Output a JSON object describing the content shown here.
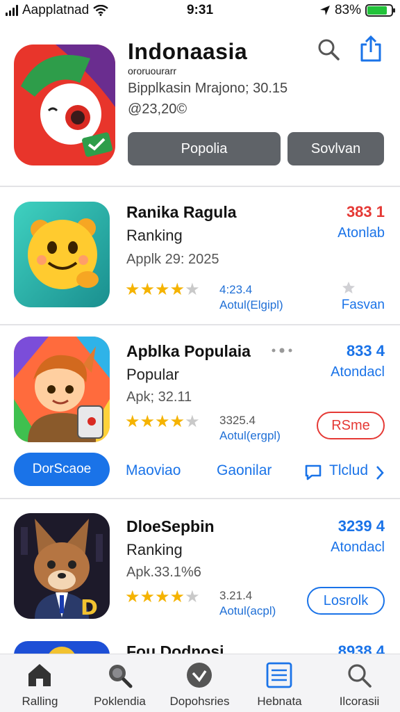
{
  "status_bar": {
    "carrier": "Aapplatnad",
    "time": "9:31",
    "battery": "83%",
    "battery_level": 0.83
  },
  "featured": {
    "title": "Indonaasia",
    "subtitle": "ororuourarr",
    "line1": "Bipplkasin Mrajono; 30.15",
    "line2": "@23,20©",
    "primary_button": "Popolia",
    "secondary_button": "Sovlvan",
    "icons": [
      "search-icon",
      "share-icon"
    ]
  },
  "apps": [
    {
      "name": "Ranika Ragula",
      "category": "Ranking",
      "version": "Applk 29: 2025",
      "rating": 4,
      "rating_value": "4:23.4",
      "rating_label": "Aotul(Elgipl)",
      "price": "383 1",
      "price_color": "#e53935",
      "link": "Atonlab",
      "action_label": "Fasvan",
      "action_icon": "star-icon"
    },
    {
      "name": "Apblka Populaia",
      "category": "Popular",
      "version": "Apk; 32.11",
      "rating": 4,
      "rating_value": "3325.4",
      "rating_label": "Aotul(ergpl)",
      "price": "833 4",
      "price_color": "#1a73e8",
      "link": "Atondacl",
      "action_label": "RSme",
      "action_color": "#e53935",
      "more_icon": "more-dots-icon"
    },
    {
      "name": "DloeSepbin",
      "category": "Ranking",
      "version": "Apk.33.1%6",
      "rating": 4,
      "rating_value": "3.21.4",
      "rating_label": "Aotul(acpl)",
      "price": "3239 4",
      "price_color": "#1a73e8",
      "link": "Atondacl",
      "action_label": "Losrolk",
      "action_color": "#1a73e8"
    },
    {
      "name": "Fou Dodnosi",
      "price": "8938 4",
      "price_color": "#1a73e8"
    }
  ],
  "actions_bar": {
    "button": "DorScaoe",
    "link1": "Maoviao",
    "link2": "Gaonilar",
    "link3": "Tlclud"
  },
  "tab_bar": [
    {
      "label": "Ralling",
      "icon": "home-icon"
    },
    {
      "label": "Poklendia",
      "icon": "search-icon"
    },
    {
      "label": "Dopohsries",
      "icon": "checkmark-icon"
    },
    {
      "label": "Hebnata",
      "icon": "list-icon"
    },
    {
      "label": "Ilcorasii",
      "icon": "search-icon"
    }
  ]
}
